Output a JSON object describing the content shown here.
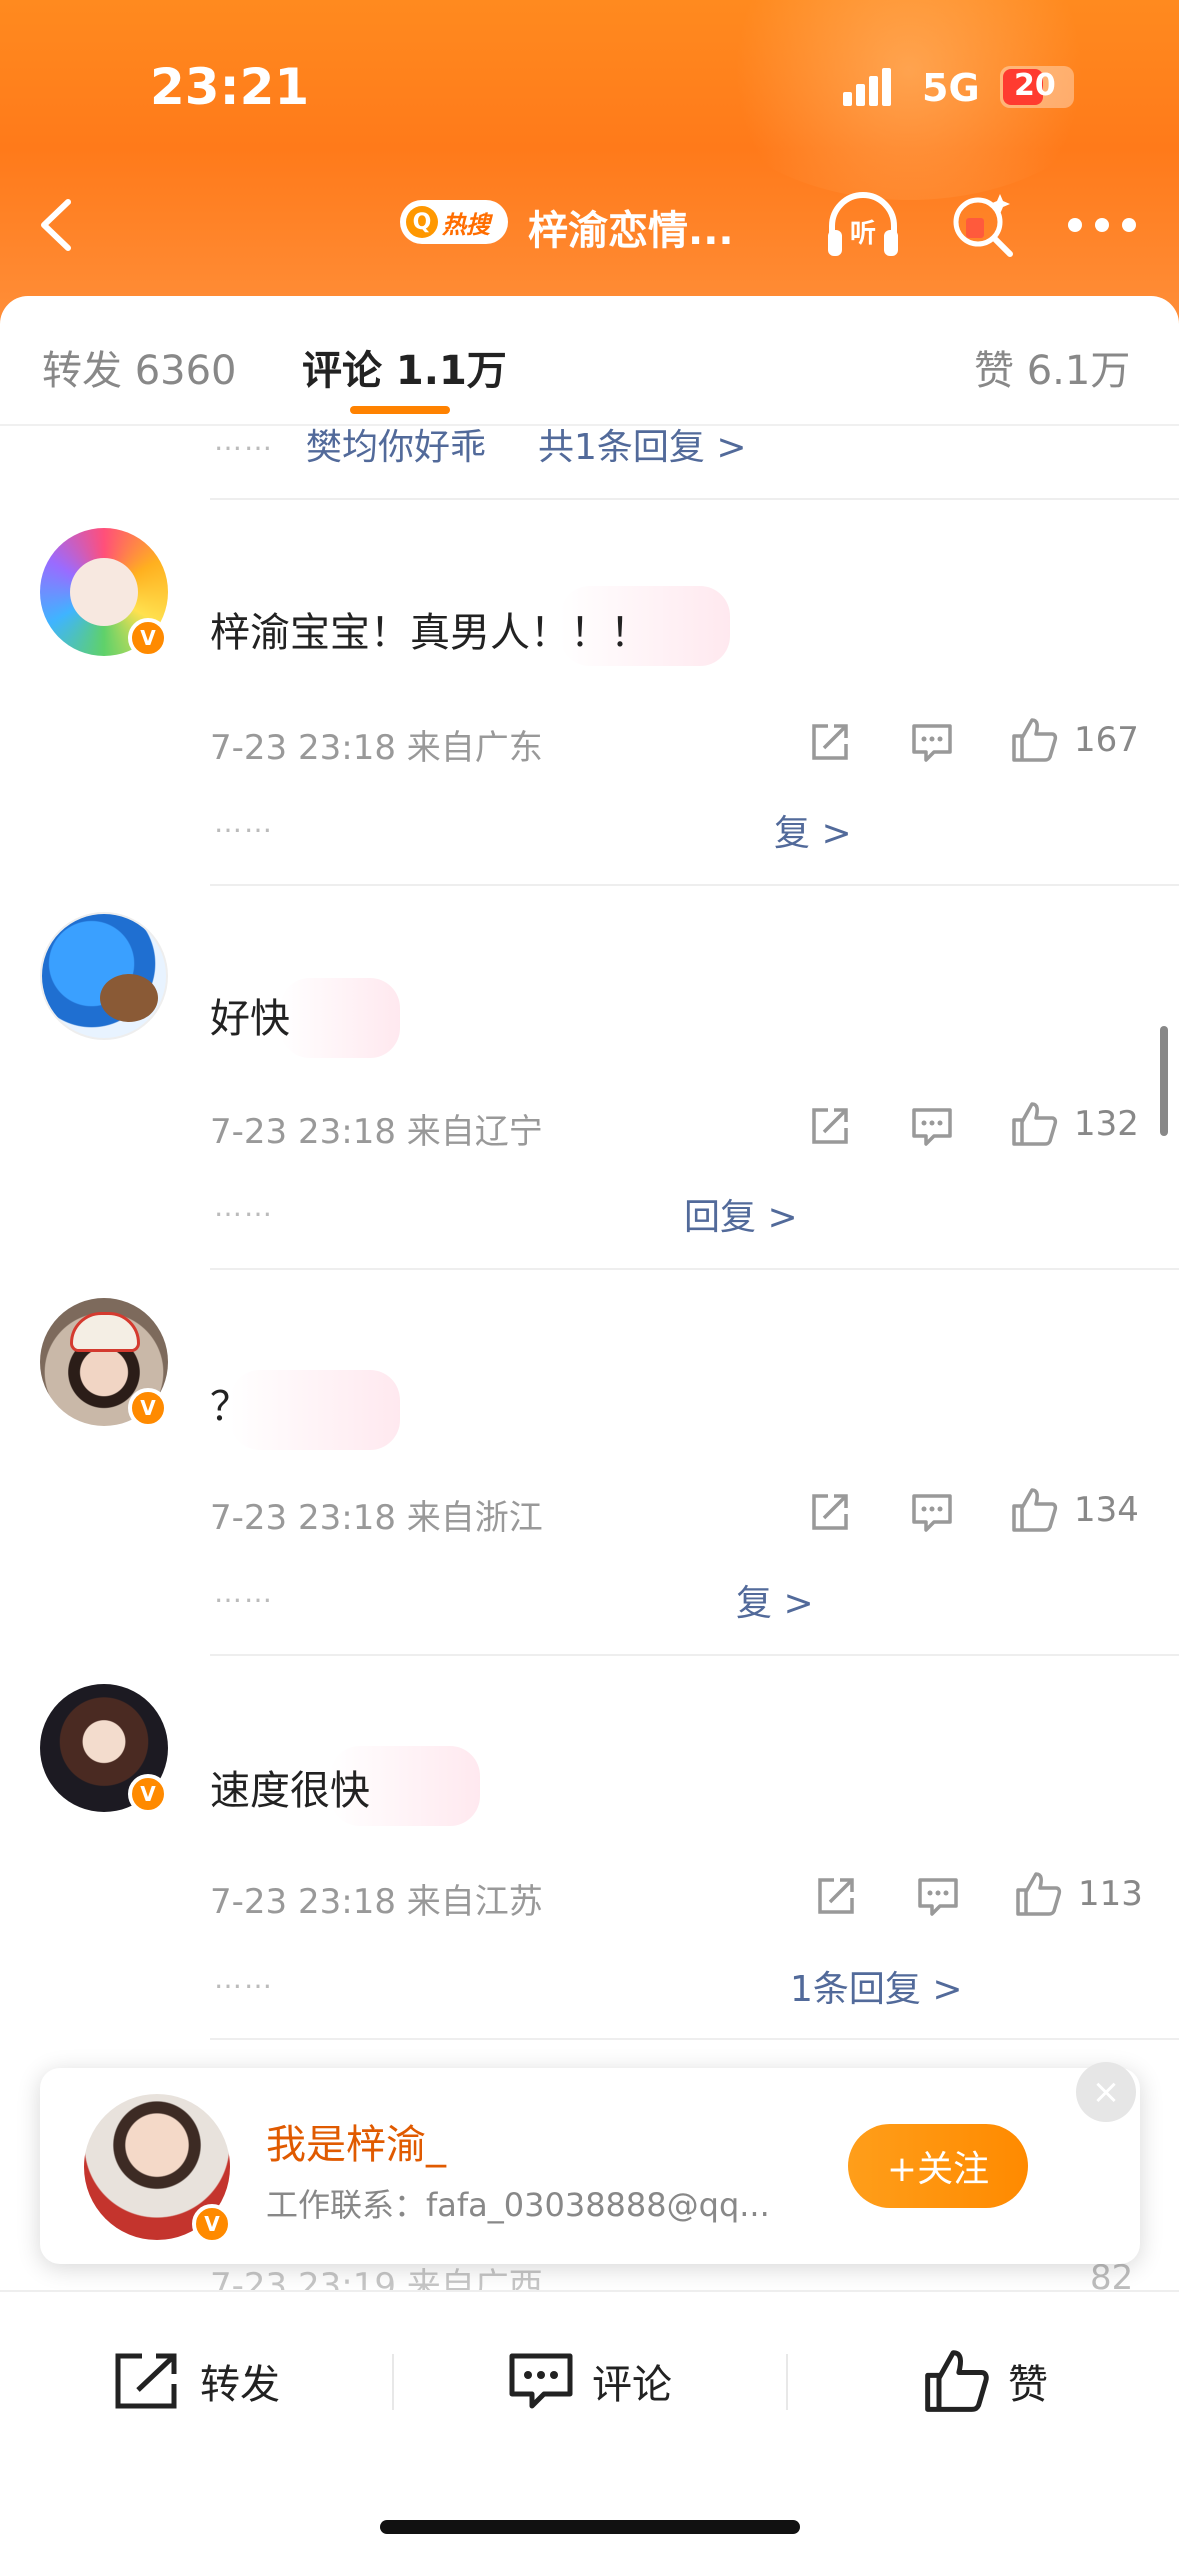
{
  "status_bar": {
    "time": "23:21",
    "network": "5G",
    "battery": "20"
  },
  "nav": {
    "hot_label": "热搜",
    "title": "梓渝恋情..."
  },
  "tabs": {
    "repost": "转发 6360",
    "comments": "评论 1.1万",
    "likes": "赞 6.1万"
  },
  "top_reply": {
    "prefix": "樊均你好乖",
    "summary": "共1条回复 >"
  },
  "comments": [
    {
      "text": "梓渝宝宝！真男人！！！",
      "meta": "7-23 23:18 来自广东",
      "likes": "167",
      "reply_hint": "复 >"
    },
    {
      "text": "好快",
      "meta": "7-23 23:18 来自辽宁",
      "likes": "132",
      "reply_hint": "回复 >"
    },
    {
      "text": "？",
      "meta": "7-23 23:18 来自浙江",
      "likes": "134",
      "reply_hint": "复 >"
    },
    {
      "text": "速度很快",
      "meta": "7-23 23:18 来自江苏",
      "likes": "113",
      "reply_hint": "1条回复 >"
    }
  ],
  "partial_row": {
    "meta": "7-23 23:19 来自广西",
    "likes": "82"
  },
  "dots": "……",
  "follow_popup": {
    "name": "我是梓渝_",
    "info": "工作联系：fafa_03038888@qq...",
    "button": "+关注",
    "close": "×"
  },
  "bottom_bar": {
    "repost": "转发",
    "comment": "评论",
    "like": "赞"
  },
  "colors": {
    "brand_orange": "#ff8200",
    "link_blue": "#526a9a"
  }
}
